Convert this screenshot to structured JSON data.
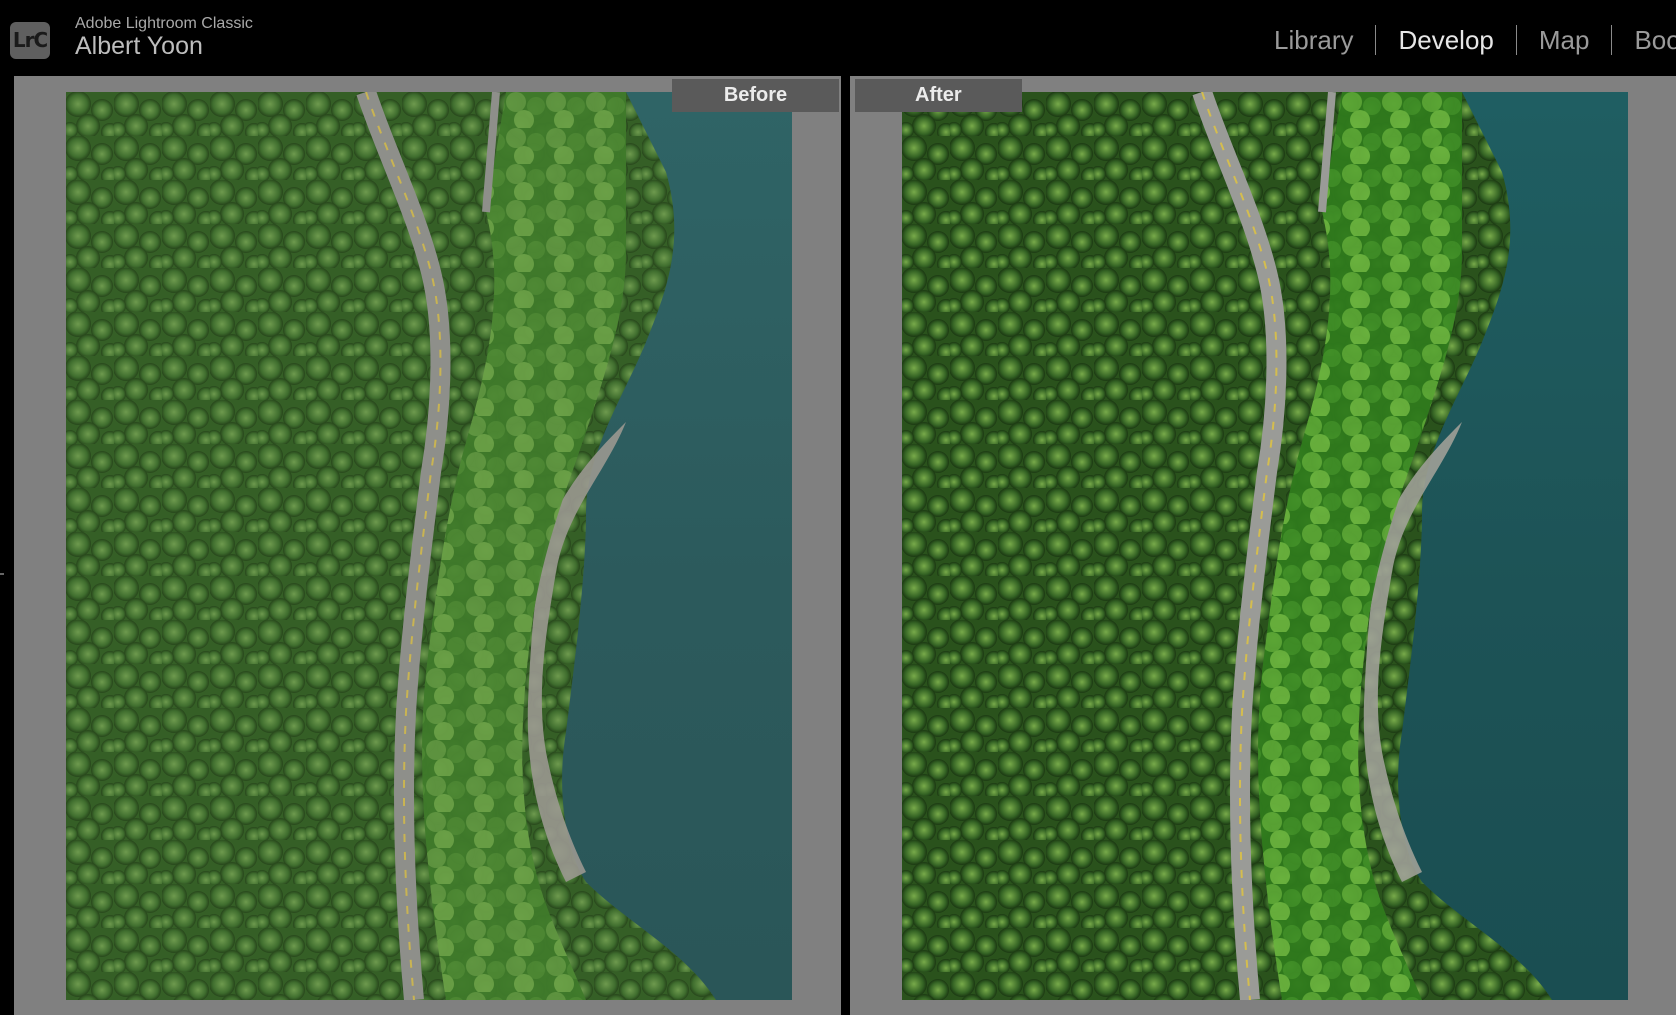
{
  "header": {
    "logo_text": "LrC",
    "app_name": "Adobe Lightroom Classic",
    "user_name": "Albert Yoon"
  },
  "modules": [
    {
      "label": "Library",
      "active": false
    },
    {
      "label": "Develop",
      "active": true
    },
    {
      "label": "Map",
      "active": false
    },
    {
      "label": "Book",
      "active": false
    }
  ],
  "compare": {
    "before_label": "Before",
    "after_label": "After"
  },
  "colors": {
    "background": "#000000",
    "panel": "#808080",
    "label_bg": "#5a5a5a",
    "water_before": "#2e5c5f",
    "water_after": "#1f5558",
    "forest_before": "#3d6a2c",
    "forest_after": "#2f5e1f"
  }
}
